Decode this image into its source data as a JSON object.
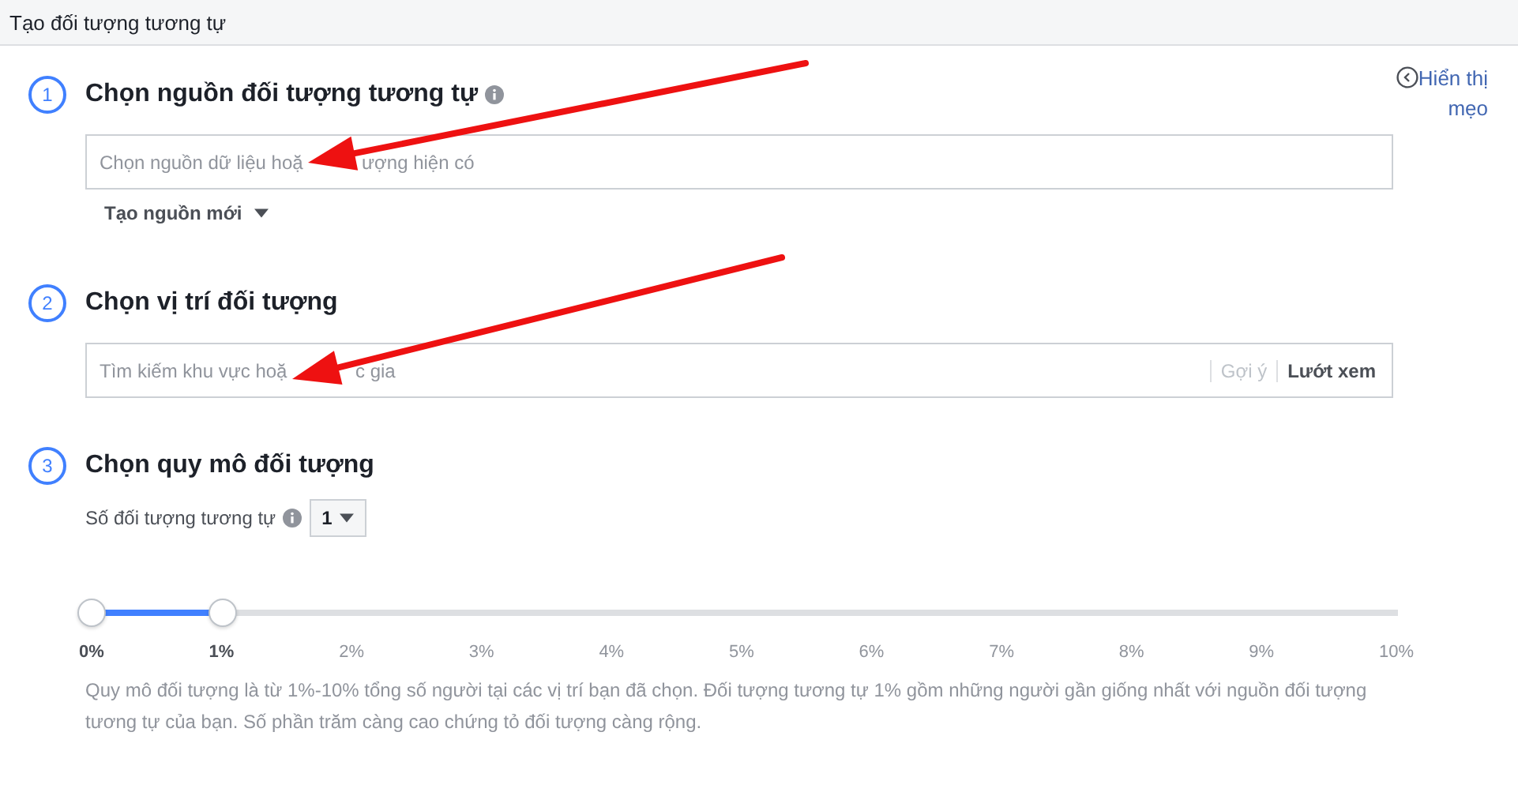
{
  "header": {
    "title": "Tạo đối tượng tương tự"
  },
  "tips_link": {
    "label": "Hiển thị mẹo"
  },
  "steps": [
    {
      "number": "1",
      "title": "Chọn nguồn đối tượng tương tự",
      "info": true,
      "kind": "source",
      "field": {
        "placeholder": "Chọn nguồn dữ liệu hoặ",
        "placeholder_tail": "ượng hiện có"
      },
      "menu": {
        "label": "Tạo nguồn mới"
      }
    },
    {
      "number": "2",
      "title": "Chọn vị trí đối tượng",
      "info": false,
      "kind": "location",
      "field": {
        "placeholder": "Tìm kiếm khu vực hoặ",
        "placeholder_tail": "c gia"
      },
      "actions": [
        {
          "label": "Gợi ý",
          "disabled": true
        },
        {
          "label": "Lướt xem",
          "disabled": false
        }
      ]
    },
    {
      "number": "3",
      "title": "Chọn quy mô đối tượng",
      "info": false,
      "kind": "size",
      "count": {
        "label": "Số đối tượng tương tự",
        "value": "1"
      },
      "slider": {
        "lower": {
          "level": 0
        },
        "upper": {
          "level": 0.1
        },
        "ticks": [
          {
            "label": "0%",
            "selected": true
          },
          {
            "label": "1%",
            "selected": true
          },
          {
            "label": "2%",
            "selected": false
          },
          {
            "label": "3%",
            "selected": false
          },
          {
            "label": "4%",
            "selected": false
          },
          {
            "label": "5%",
            "selected": false
          },
          {
            "label": "6%",
            "selected": false
          },
          {
            "label": "7%",
            "selected": false
          },
          {
            "label": "8%",
            "selected": false
          },
          {
            "label": "9%",
            "selected": false
          },
          {
            "label": "10%",
            "selected": false
          }
        ]
      },
      "description": "Quy mô đối tượng là từ 1%-10% tổng số người tại các vị trí bạn đã chọn. Đối tượng tương tự 1% gồm những người gần giống nhất với nguồn đối tượng tương tự của bạn. Số phần trăm càng cao chứng tỏ đối tượng càng rộng."
    }
  ],
  "annotations": [
    {
      "kind": "arrow"
    },
    {
      "kind": "arrow"
    }
  ]
}
